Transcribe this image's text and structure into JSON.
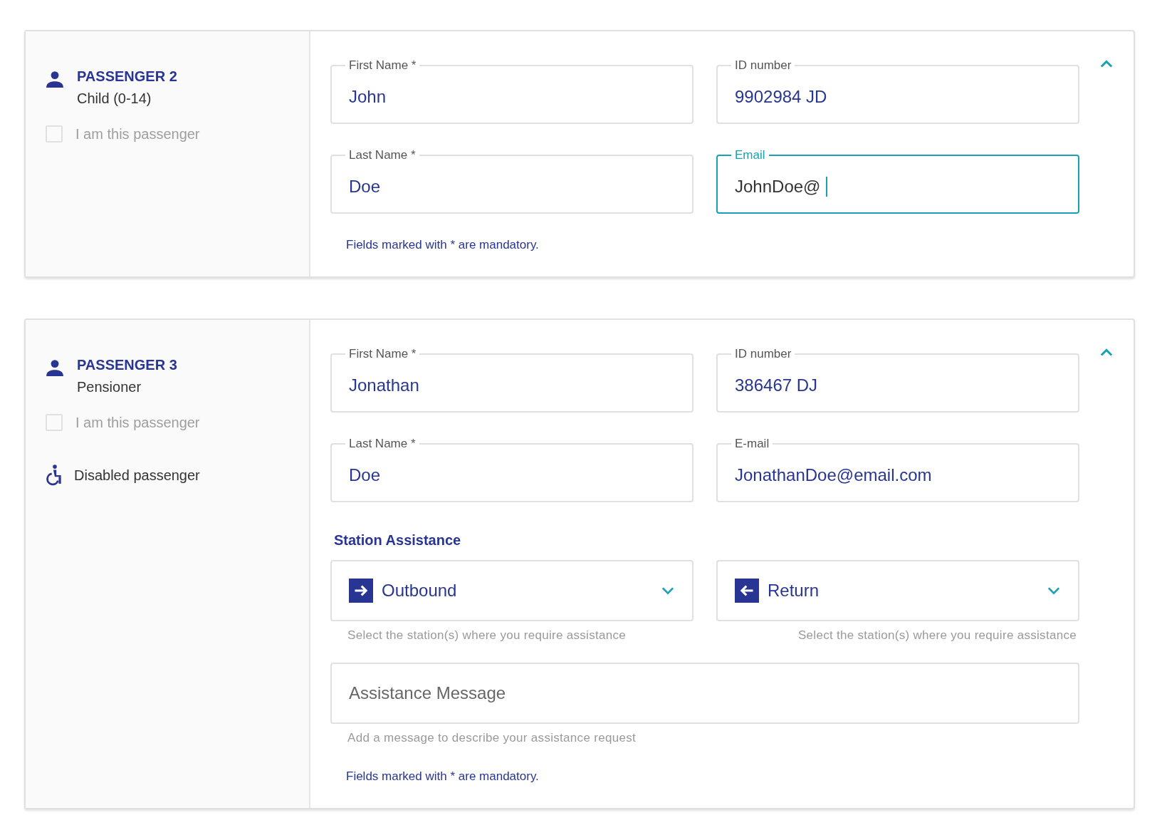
{
  "passengers": [
    {
      "title": "PASSENGER 2",
      "category": "Child (0-14)",
      "expanded": true,
      "self_checkbox": {
        "label": "I am this passenger",
        "checked": false,
        "disabled": true
      },
      "fields": [
        {
          "label": "First Name *",
          "value": "John",
          "focused": false
        },
        {
          "label": "ID number",
          "value": "9902984 JD",
          "focused": false
        },
        {
          "label": "Last Name *",
          "value": "Doe",
          "focused": false
        },
        {
          "label": "Email",
          "value": "JohnDoe@",
          "focused": true
        }
      ],
      "note": "Fields marked with * are mandatory."
    },
    {
      "title": "PASSENGER 3",
      "category": "Pensioner",
      "expanded": true,
      "self_checkbox": {
        "label": "I am this passenger",
        "checked": false,
        "disabled": true
      },
      "disabled_passenger": {
        "label": "Disabled passenger"
      },
      "fields": [
        {
          "label": "First Name *",
          "value": "Jonathan",
          "focused": false
        },
        {
          "label": "ID number",
          "value": "386467 DJ",
          "focused": false
        },
        {
          "label": "Last Name *",
          "value": "Doe",
          "focused": false
        },
        {
          "label": "E-mail",
          "value": "JonathanDoe@email.com",
          "focused": false
        }
      ],
      "station_assistance": {
        "heading": "Station Assistance",
        "selects": [
          {
            "kind": "outbound",
            "value": "Outbound",
            "helper": "Select the station(s) where you require assistance"
          },
          {
            "kind": "return",
            "value": "Return",
            "helper": "Select the station(s) where you require assistance"
          }
        ],
        "message": {
          "placeholder": "Assistance Message",
          "helper": "Add a message to describe your assistance request"
        }
      },
      "note": "Fields marked with * are mandatory."
    }
  ]
}
